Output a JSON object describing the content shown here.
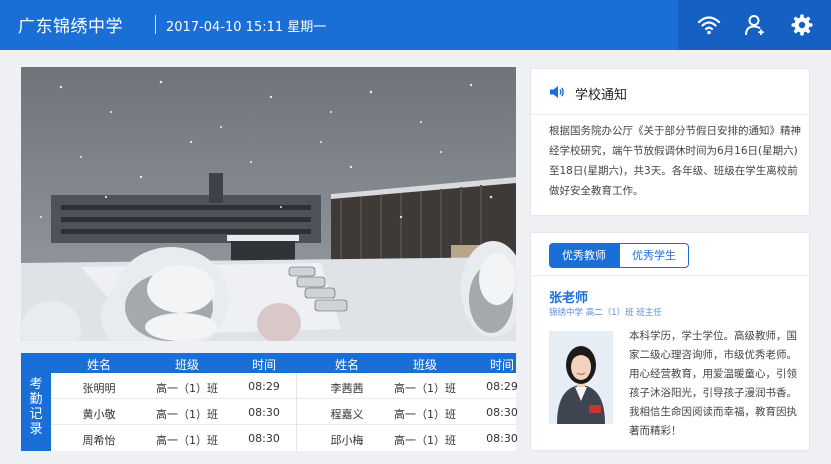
{
  "header": {
    "school_name": "广东锦绣中学",
    "datetime": "2017-04-10 15:11 星期一"
  },
  "attendance": {
    "side_label_chars": [
      "考",
      "勤",
      "记",
      "录"
    ],
    "columns": [
      "姓名",
      "班级",
      "时间",
      "姓名",
      "班级",
      "时间"
    ],
    "rows": [
      [
        "张明明",
        "高一（1）班",
        "08:29",
        "李茜茜",
        "高一（1）班",
        "08:29"
      ],
      [
        "黄小敬",
        "高一（1）班",
        "08:30",
        "程嘉义",
        "高一（1）班",
        "08:30"
      ],
      [
        "周希怡",
        "高一（1）班",
        "08:30",
        "邱小梅",
        "高一（1）班",
        "08:30"
      ]
    ]
  },
  "notice": {
    "title": "学校通知",
    "text": "根据国务院办公厅《关于部分节假日安排的通知》精神经学校研究，端午节放假调休时间为6月16日(星期六)至18日(星期六)，共3天。各年级、班级在学生离校前做好安全教育工作。"
  },
  "excellent": {
    "tabs": [
      "优秀教师",
      "优秀学生"
    ],
    "teacher_name": "张老师",
    "teacher_class": "锦绣中学 高二（1）班 班主任",
    "teacher_desc": "本科学历，学士学位。高级教师，国家二级心理咨询师，市级优秀老师。用心经营教育，用爱温暖童心，引领孩子沐浴阳光，引导孩子漫润书香。我相信生命因阅读而幸福，教育因执著而精彩！"
  },
  "colors": {
    "primary": "#1a6fd6",
    "primary_dark": "#1560c2"
  },
  "icons": [
    "wifi-icon",
    "user-add-icon",
    "gear-icon",
    "speaker-icon"
  ]
}
